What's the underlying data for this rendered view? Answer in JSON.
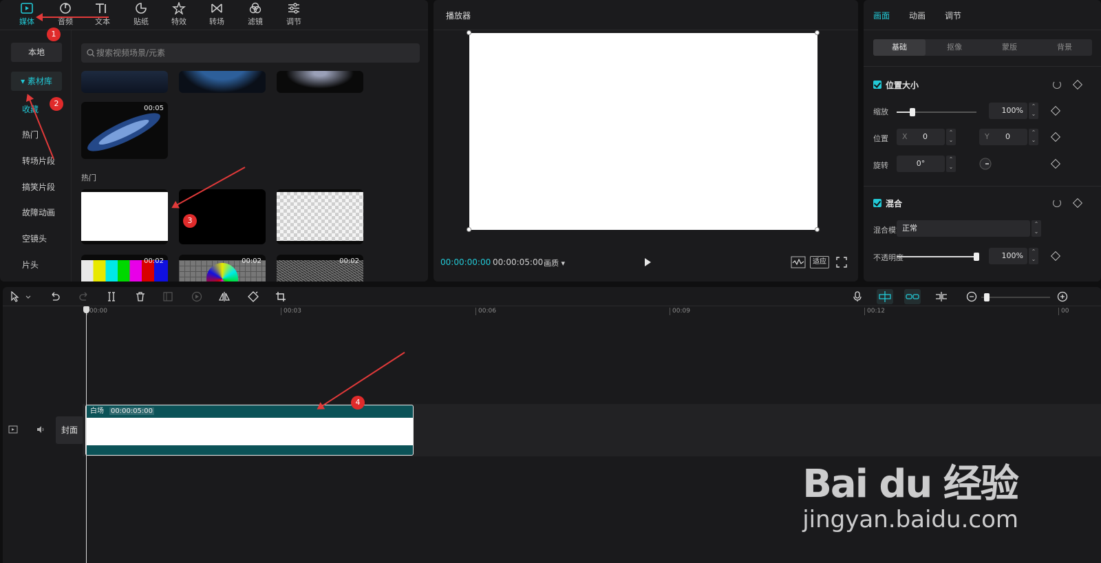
{
  "media": {
    "tabs": [
      {
        "label": "媒体",
        "icon": "media-icon",
        "active": true
      },
      {
        "label": "音频",
        "icon": "audio-icon"
      },
      {
        "label": "文本",
        "icon": "text-icon"
      },
      {
        "label": "贴纸",
        "icon": "sticker-icon"
      },
      {
        "label": "特效",
        "icon": "effects-icon"
      },
      {
        "label": "转场",
        "icon": "transition-icon"
      },
      {
        "label": "滤镜",
        "icon": "filter-icon"
      },
      {
        "label": "调节",
        "icon": "adjust-icon"
      }
    ],
    "side": {
      "local": "本地",
      "library": "素材库",
      "items": [
        "收藏",
        "热门",
        "转场片段",
        "搞笑片段",
        "故障动画",
        "空镜头",
        "片头"
      ]
    },
    "search_placeholder": "搜索视频场景/元素",
    "thumbs": [
      {
        "duration": "00:05"
      }
    ],
    "section_label": "热门",
    "hot_thumbs": [
      {
        "duration": "00:02"
      },
      {
        "duration": "00:02"
      },
      {
        "duration": "00:02"
      }
    ]
  },
  "annotations": [
    "1",
    "2",
    "3",
    "4"
  ],
  "player": {
    "title": "播放器",
    "current_time": "00:00:00:00",
    "total_time": "00:00:05:00",
    "quality": "画质",
    "fit_label": "适应"
  },
  "props": {
    "tabs": [
      "画面",
      "动画",
      "调节"
    ],
    "subtabs": [
      "基础",
      "抠像",
      "蒙版",
      "背景"
    ],
    "position_section": "位置大小",
    "scale_label": "缩放",
    "scale_value": "100%",
    "scale_fraction": 0.2,
    "position_label": "位置",
    "x_label": "X",
    "x_value": "0",
    "y_label": "Y",
    "y_value": "0",
    "rotate_label": "旋转",
    "rotate_value": "0°",
    "blend_section": "混合",
    "blend_mode_label": "混合模式",
    "blend_mode_value": "正常",
    "opacity_label": "不透明度",
    "opacity_value": "100%",
    "opacity_fraction": 1.0
  },
  "timeline": {
    "ticks": [
      "00:00",
      "00:03",
      "00:06",
      "00:09",
      "00:12",
      "00"
    ],
    "clip_name": "白场",
    "clip_duration": "00:00:05:00",
    "cover_label": "封面"
  },
  "watermark": {
    "logo": "Bai du 经验",
    "url": "jingyan.baidu.com"
  },
  "colors": {
    "accent": "#22c9d6",
    "clip_teal": "#0b5257",
    "annotation_red": "#e02b2b"
  }
}
